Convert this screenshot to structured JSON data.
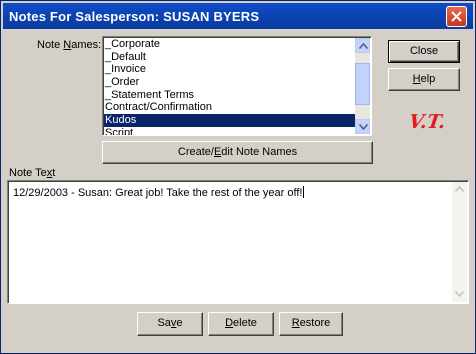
{
  "window": {
    "title": "Notes For Salesperson: SUSAN BYERS"
  },
  "note_names": {
    "label_prefix": "Note ",
    "label_underline": "N",
    "label_suffix": "ames:",
    "items": [
      "_Corporate",
      "_Default",
      "_Invoice",
      "_Order",
      "_Statement Terms",
      "Contract/Confirmation",
      "Kudos",
      "Script"
    ],
    "selected": "Kudos"
  },
  "buttons": {
    "close": "Close",
    "help_prefix": "",
    "help_underline": "H",
    "help_suffix": "elp",
    "create_edit_prefix": "Create/",
    "create_edit_underline": "E",
    "create_edit_suffix": "dit Note Names",
    "save_prefix": "Sa",
    "save_underline": "v",
    "save_suffix": "e",
    "delete_prefix": "",
    "delete_underline": "D",
    "delete_suffix": "elete",
    "restore_prefix": "",
    "restore_underline": "R",
    "restore_suffix": "estore"
  },
  "note_text": {
    "label_prefix": "Note Te",
    "label_underline": "x",
    "label_suffix": "t",
    "value": "12/29/2003 - Susan:  Great job!  Take the rest of the year off!"
  },
  "signature": "V.T.",
  "colors": {
    "title_bar": "#0a3b9e",
    "selection": "#0a246a",
    "window_bg": "#d4d0c8",
    "signature": "#e31b1b"
  }
}
